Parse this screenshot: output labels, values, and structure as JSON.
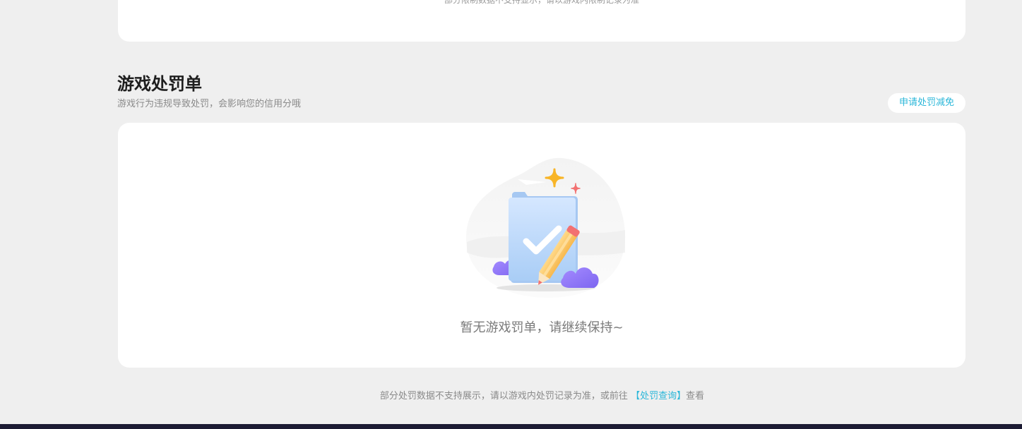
{
  "top_card": {
    "note": "部分限制数据不支持显示，请以游戏内限制记录为准"
  },
  "section": {
    "title": "游戏处罚单",
    "subtitle": "游戏行为违规导致处罚，会影响您的信用分哦",
    "appeal_label": "申请处罚减免"
  },
  "empty_state": {
    "icon": "empty-document-pencil-illustration",
    "text": "暂无游戏罚单，请继续保持~"
  },
  "footer": {
    "text_before": "部分处罚数据不支持展示，请以游戏内处罚记录为准，或前往",
    "link_label": "【处罚查询】",
    "text_after": "查看"
  },
  "colors": {
    "background": "#efefef",
    "card": "#ffffff",
    "accent": "#2bb7d9",
    "bottom_bar": "#1c1b33"
  }
}
